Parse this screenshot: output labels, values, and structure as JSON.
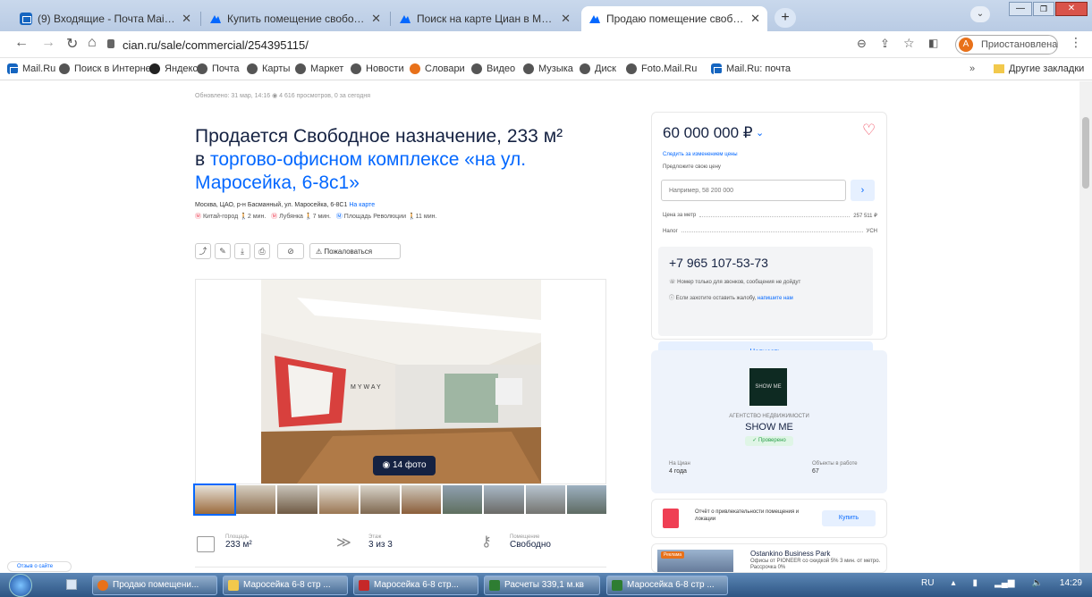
{
  "browser": {
    "tabs": [
      {
        "title": "(9) Входящие - Почта Mail.ru",
        "active": false
      },
      {
        "title": "Купить помещение свободного",
        "active": false
      },
      {
        "title": "Поиск на карте Циан в Москве",
        "active": false
      },
      {
        "title": "Продаю помещение свободно",
        "active": true
      }
    ],
    "url": "cian.ru/sale/commercial/254395115/",
    "profile_status": "Приостановлена",
    "profile_initial": "А",
    "bookmarks": [
      "Mail.Ru",
      "Поиск в Интернете",
      "Яндекс",
      "Почта",
      "Карты",
      "Маркет",
      "Новости",
      "Словари",
      "Видео",
      "Музыка",
      "Диск",
      "Foto.Mail.Ru",
      "Mail.Ru: почта"
    ],
    "other_bookmarks": "Другие закладки"
  },
  "listing": {
    "updated": "Обновлено: 31 мар, 14:16",
    "views": "4 616 просмотров, 0 за сегодня",
    "title_line1": "Продается Свободное назначение, 233 м²",
    "title_prefix": "в ",
    "title_link": "торгово-офисном комплексе «на ул. Маросейка, 6-8с1»",
    "address": "Москва, ЦАО, р-н Басманный, ул. Маросейка, 6-8С1",
    "map_link": "На карте",
    "metro": [
      {
        "name": "Китай-город",
        "time": "2 мин."
      },
      {
        "name": "Лубянка",
        "time": "7 мин."
      },
      {
        "name": "Площадь Революции",
        "time": "11 мин."
      }
    ],
    "complain_label": "Пожаловаться",
    "photo_count": "14 фото",
    "photo_sign": "MYWAY",
    "features": [
      {
        "label": "Площадь",
        "value": "233 м²"
      },
      {
        "label": "Этаж",
        "value": "3 из 3"
      },
      {
        "label": "Помещение",
        "value": "Свободно"
      }
    ]
  },
  "sidebar": {
    "price": "60 000 000 ₽",
    "follow_link": "Следить за изменением цены",
    "offer_label": "Предложите свою цену",
    "offer_placeholder": "Например, 58 200 000",
    "price_per_m_label": "Цена за метр",
    "price_per_m": "257 511 ₽",
    "tax_label": "Налог",
    "tax": "УСН",
    "phone": "+7 965 107-53-73",
    "phone_note": "Номер только для звонков, сообщения не дойдут",
    "complaint_note": "Если захотите оставить жалобу,",
    "complaint_link": "напишите нам",
    "write_label": "Написать",
    "agent_type": "АГЕНТСТВО НЕДВИЖИМОСТИ",
    "agent_name": "SHOW ME",
    "agent_logo": "SHOW ME",
    "agent_badge": "Проверено",
    "on_cian_label": "На Циан",
    "on_cian_value": "4 года",
    "objects_label": "Объекты в работе",
    "objects_value": "67",
    "report_text": "Отчёт о привлекательности помещения и локации",
    "buy_label": "Купить",
    "ad_badge": "Реклама",
    "ad_name": "Ostankino Business Park",
    "ad_text": "Офисы от PIONEER со скидкой 5% 3 мин. от метро. Рассрочка 0%"
  },
  "feedback": "Отзыв о сайте",
  "taskbar": {
    "items": [
      "Продаю помещени...",
      "Маросейка 6-8 стр ...",
      "Маросейка 6-8 стр...",
      "Расчеты 339,1 м.кв",
      "Маросейка 6-8 стр ..."
    ],
    "lang": "RU",
    "time": "14:29"
  },
  "colors": {
    "accent": "#0468ff",
    "title": "#152242",
    "heart": "#ef3f54"
  }
}
